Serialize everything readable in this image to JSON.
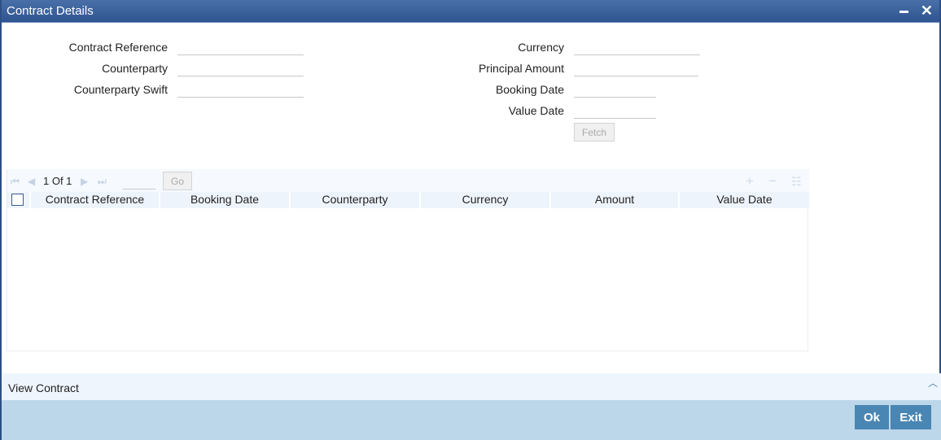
{
  "window": {
    "title": "Contract Details",
    "minimize_icon": "minimize-icon",
    "close_icon": "close-icon"
  },
  "form": {
    "left": [
      {
        "label": "Contract Reference",
        "value": ""
      },
      {
        "label": "Counterparty",
        "value": ""
      },
      {
        "label": "Counterparty Swift",
        "value": ""
      }
    ],
    "right": [
      {
        "label": "Currency",
        "value": ""
      },
      {
        "label": "Principal Amount",
        "value": ""
      },
      {
        "label": "Booking Date",
        "value": ""
      },
      {
        "label": "Value Date",
        "value": ""
      }
    ],
    "fetch_label": "Fetch"
  },
  "grid": {
    "page_info": "1 Of 1",
    "page_input": "",
    "go_label": "Go",
    "toolbar_icons": [
      "add-row-icon",
      "delete-row-icon",
      "single-view-icon"
    ],
    "columns": [
      "Contract Reference",
      "Booking Date",
      "Counterparty",
      "Currency",
      "Amount",
      "Value Date"
    ],
    "rows": []
  },
  "footer": {
    "section_label": "View Contract",
    "ok_label": "Ok",
    "exit_label": "Exit"
  },
  "colors": {
    "titlebar": "#2e5590",
    "action_bar": "#bdd7ea",
    "button": "#4a86b3",
    "grid_header": "#eef4fc"
  }
}
